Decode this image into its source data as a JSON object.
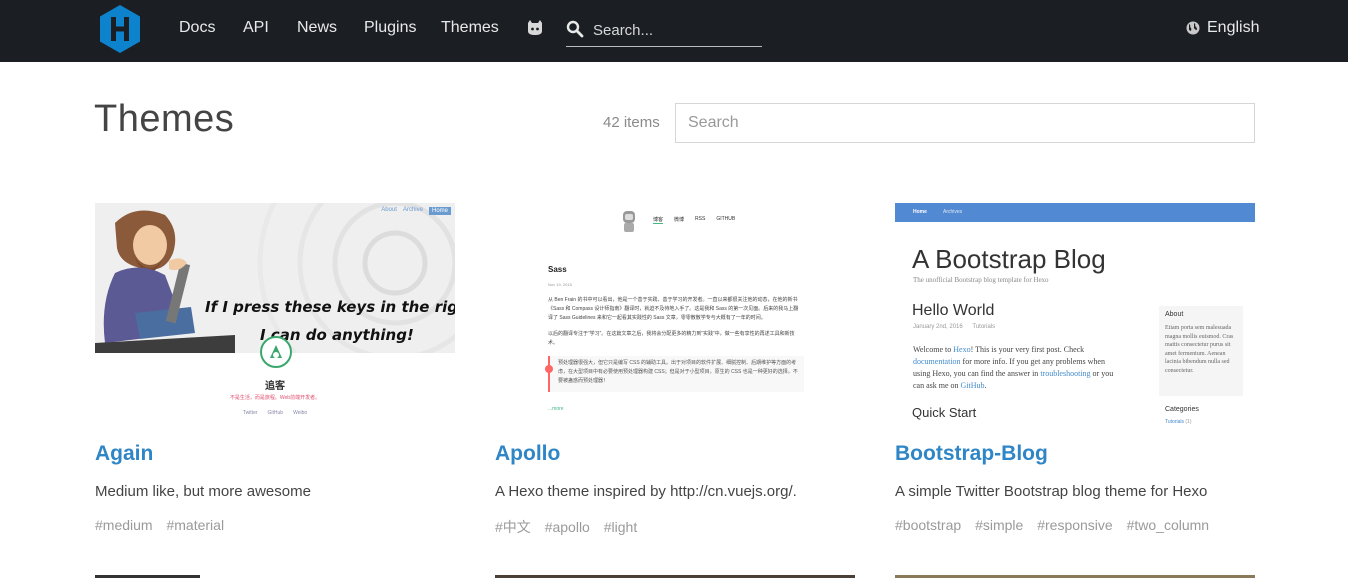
{
  "header": {
    "nav": [
      "Docs",
      "API",
      "News",
      "Plugins",
      "Themes"
    ],
    "search_placeholder": "Search...",
    "language": "English"
  },
  "page": {
    "title": "Themes",
    "count": "42 items",
    "filter_placeholder": "Search"
  },
  "themes": [
    {
      "name": "Again",
      "description": "Medium like, but more awesome",
      "tags": [
        "#medium",
        "#material"
      ],
      "preview": {
        "nav": [
          "About",
          "Archive",
          "Home"
        ],
        "handwriting_1": "If I press these keys in the right order,",
        "handwriting_2": "I can do anything!",
        "blog_name": "追客",
        "blog_tagline": "不是生活，而是旅程。Web前端开发者。",
        "social": [
          "Twitter",
          "GitHub",
          "Weibo"
        ]
      }
    },
    {
      "name": "Apollo",
      "description": "A Hexo theme inspired by http://cn.vuejs.org/.",
      "tags": [
        "#中文",
        "#apollo",
        "#light"
      ],
      "preview": {
        "nav": [
          "博客",
          "微博",
          "RSS",
          "GITHUB"
        ],
        "post_title": "Sass",
        "post_date": "Nov 19, 2015",
        "para_1": "从 Ben Frain 的书中可以看出，他是一个善于实践、善于学习的开发者。一直以来都很关注他的动态，在他的新书《Sass 和 Compass 设计师指南》翻译时，就迫不及待地入手了。这是我和 Sass 的第一次见面。后来的我马上翻译了 Sass Guidelines 来和它一起看其实践性的 Sass 文章，零零散散学专与大概有了一年的时间。",
        "para_2": "以后的翻译专注于“学习”。在这篇文章之后，我将会分配更多的精力到“实践”中，做一些有享性的再述工具和新技术。",
        "quote": "预处理器很强大，但它只是编写 CSS 的辅助工具。出于对项目的软件扩展、细腻控制、后期维护等方面的考虑，在大型项目中有必要使用预处理器构建 CSS；但是对于小型项目，原生的 CSS 也是一种更好的选择。不要被蛊惑而预处理器！",
        "more": "...more"
      }
    },
    {
      "name": "Bootstrap-Blog",
      "description": "A simple Twitter Bootstrap blog theme for Hexo",
      "tags": [
        "#bootstrap",
        "#simple",
        "#responsive",
        "#two_column"
      ],
      "preview": {
        "nav": [
          "Home",
          "Archives"
        ],
        "blog_title": "A Bootstrap Blog",
        "blog_subtitle": "The unofficial Bootstrap blog template for Hexo",
        "post_title": "Hello World",
        "post_date": "January 2nd, 2016",
        "post_category": "Tutorials",
        "post_text_1": "Welcome to ",
        "post_link_1": "Hexo",
        "post_text_2": "! This is your very first post. Check ",
        "post_link_2": "documentation",
        "post_text_3": " for more info. If you get any problems when using Hexo, you can find the answer in ",
        "post_link_3": "troubleshooting",
        "post_text_4": " or you can ask me on ",
        "post_link_4": "GitHub",
        "post_text_5": ".",
        "section": "Quick Start",
        "about_title": "About",
        "about_text": "Etiam porta sem malesuada magna mollis euismod. Cras mattis consectetur purus sit amet fermentum. Aenean lacinia bibendum nulla sed consectetur.",
        "categories_title": "Categories",
        "category": "Tutorials",
        "category_count": "(1)"
      }
    }
  ],
  "colors": {
    "header_bg": "#1b1f24",
    "logo": "#0e83cd",
    "title_link": "#2f86c7",
    "bootstrap_nav": "#5289d3",
    "apollo_accent": "#42b983"
  },
  "icons": {
    "logo": "hexo-logo",
    "ghost": "github-octocat-icon",
    "search": "search-icon",
    "language": "globe-icon"
  }
}
